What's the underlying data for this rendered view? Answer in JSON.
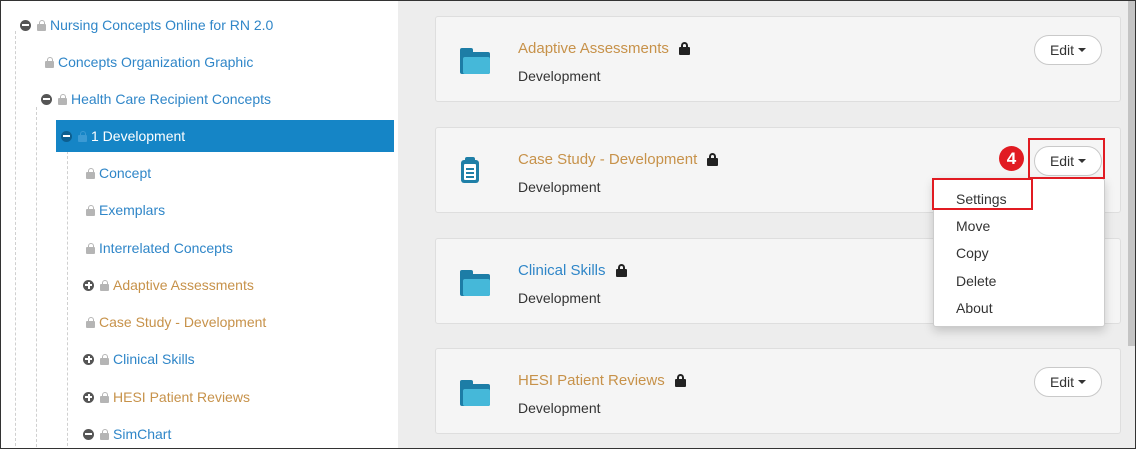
{
  "tree": {
    "root": "Nursing Concepts Online for RN 2.0",
    "org_graphic": "Concepts Organization Graphic",
    "recipient": "Health Care Recipient Concepts",
    "selected": "1 Development",
    "items": [
      "Concept",
      "Exemplars",
      "Interrelated Concepts",
      "Adaptive Assessments",
      "Case Study - Development",
      "Clinical Skills",
      "HESI Patient Reviews",
      "SimChart"
    ]
  },
  "cards": [
    {
      "title": "Adaptive Assessments",
      "subtitle": "Development",
      "icon": "folder-icon",
      "edit": "Edit"
    },
    {
      "title": "Case Study - Development",
      "subtitle": "Development",
      "icon": "clipboard-icon",
      "edit": "Edit"
    },
    {
      "title": "Clinical Skills",
      "subtitle": "Development",
      "icon": "folder-icon"
    },
    {
      "title": "HESI Patient Reviews",
      "subtitle": "Development",
      "icon": "folder-icon",
      "edit": "Edit"
    }
  ],
  "menu": {
    "items": [
      "Settings",
      "Move",
      "Copy",
      "Delete",
      "About"
    ]
  },
  "step_badge": "4",
  "colors": {
    "link_blue": "#2f86c8",
    "link_orange": "#c7924a",
    "selected_bg": "#1585c6",
    "highlight_red": "#e11b22"
  }
}
